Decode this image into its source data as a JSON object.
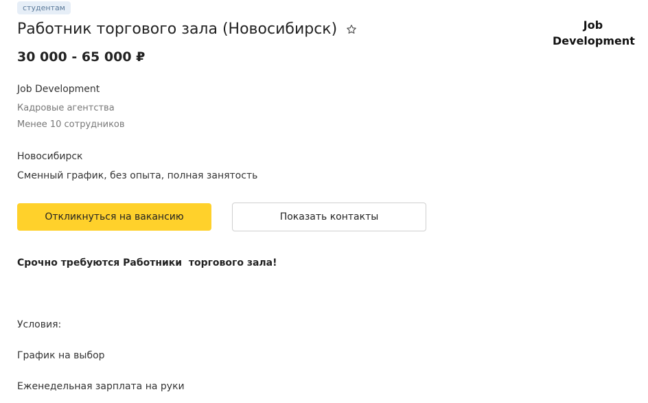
{
  "badge": "студентам",
  "vacancy": {
    "title": "Работник торгового зала (Новосибирск)",
    "salary": "30 000 - 65 000 ₽"
  },
  "logo": {
    "line1": "Job",
    "line2": "Development"
  },
  "company": {
    "name": "Job Development",
    "industry": "Кадровые агентства",
    "size": "Менее 10 сотрудников"
  },
  "location": {
    "city": "Новосибирск",
    "schedule": "Сменный график, без опыта, полная занятость"
  },
  "actions": {
    "apply_label": "Откликнуться на вакансию",
    "contacts_label": "Показать контакты"
  },
  "description": {
    "lead": "Срочно требуются Работники  торгового зала!",
    "conditions_heading": "Условия:",
    "items": [
      "График на выбор",
      "Еженедельная зарплата на руки"
    ]
  },
  "colors": {
    "accent": "#ffd12b",
    "badge_bg": "#e6eef7",
    "badge_text": "#5b7a9a"
  },
  "icons": {
    "favorite": "star-outline-icon"
  }
}
